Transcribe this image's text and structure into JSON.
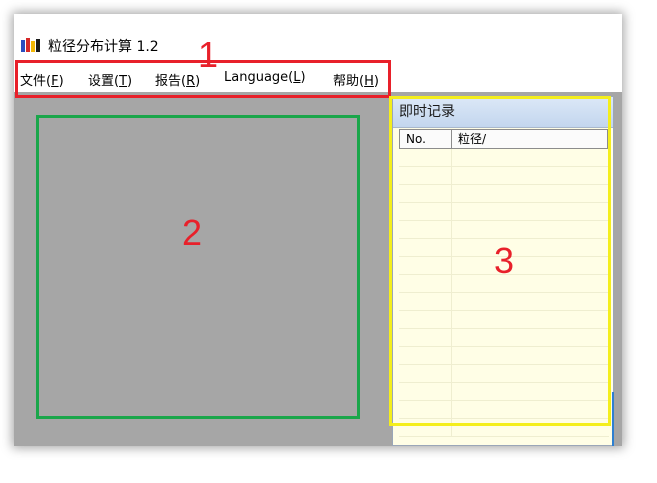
{
  "window": {
    "title": "粒径分布计算 1.2",
    "icon": "app-logo-icon"
  },
  "menubar": {
    "items": [
      {
        "label": "文件",
        "accel": "F"
      },
      {
        "label": "设置",
        "accel": "T"
      },
      {
        "label": "报告",
        "accel": "R"
      },
      {
        "label": "Language",
        "accel": "L"
      },
      {
        "label": "帮助",
        "accel": "H"
      }
    ]
  },
  "record_panel": {
    "title": "即时记录",
    "columns": [
      "No.",
      "粒径/"
    ]
  },
  "annotations": {
    "one": "1",
    "two": "2",
    "three": "3"
  },
  "colors": {
    "annotation_red": "#e8202a",
    "annotation_green": "#1aa64a",
    "annotation_yellow": "#f4ee1c",
    "workspace_gray": "#a6a6a6",
    "panel_bg": "#fffee6"
  }
}
